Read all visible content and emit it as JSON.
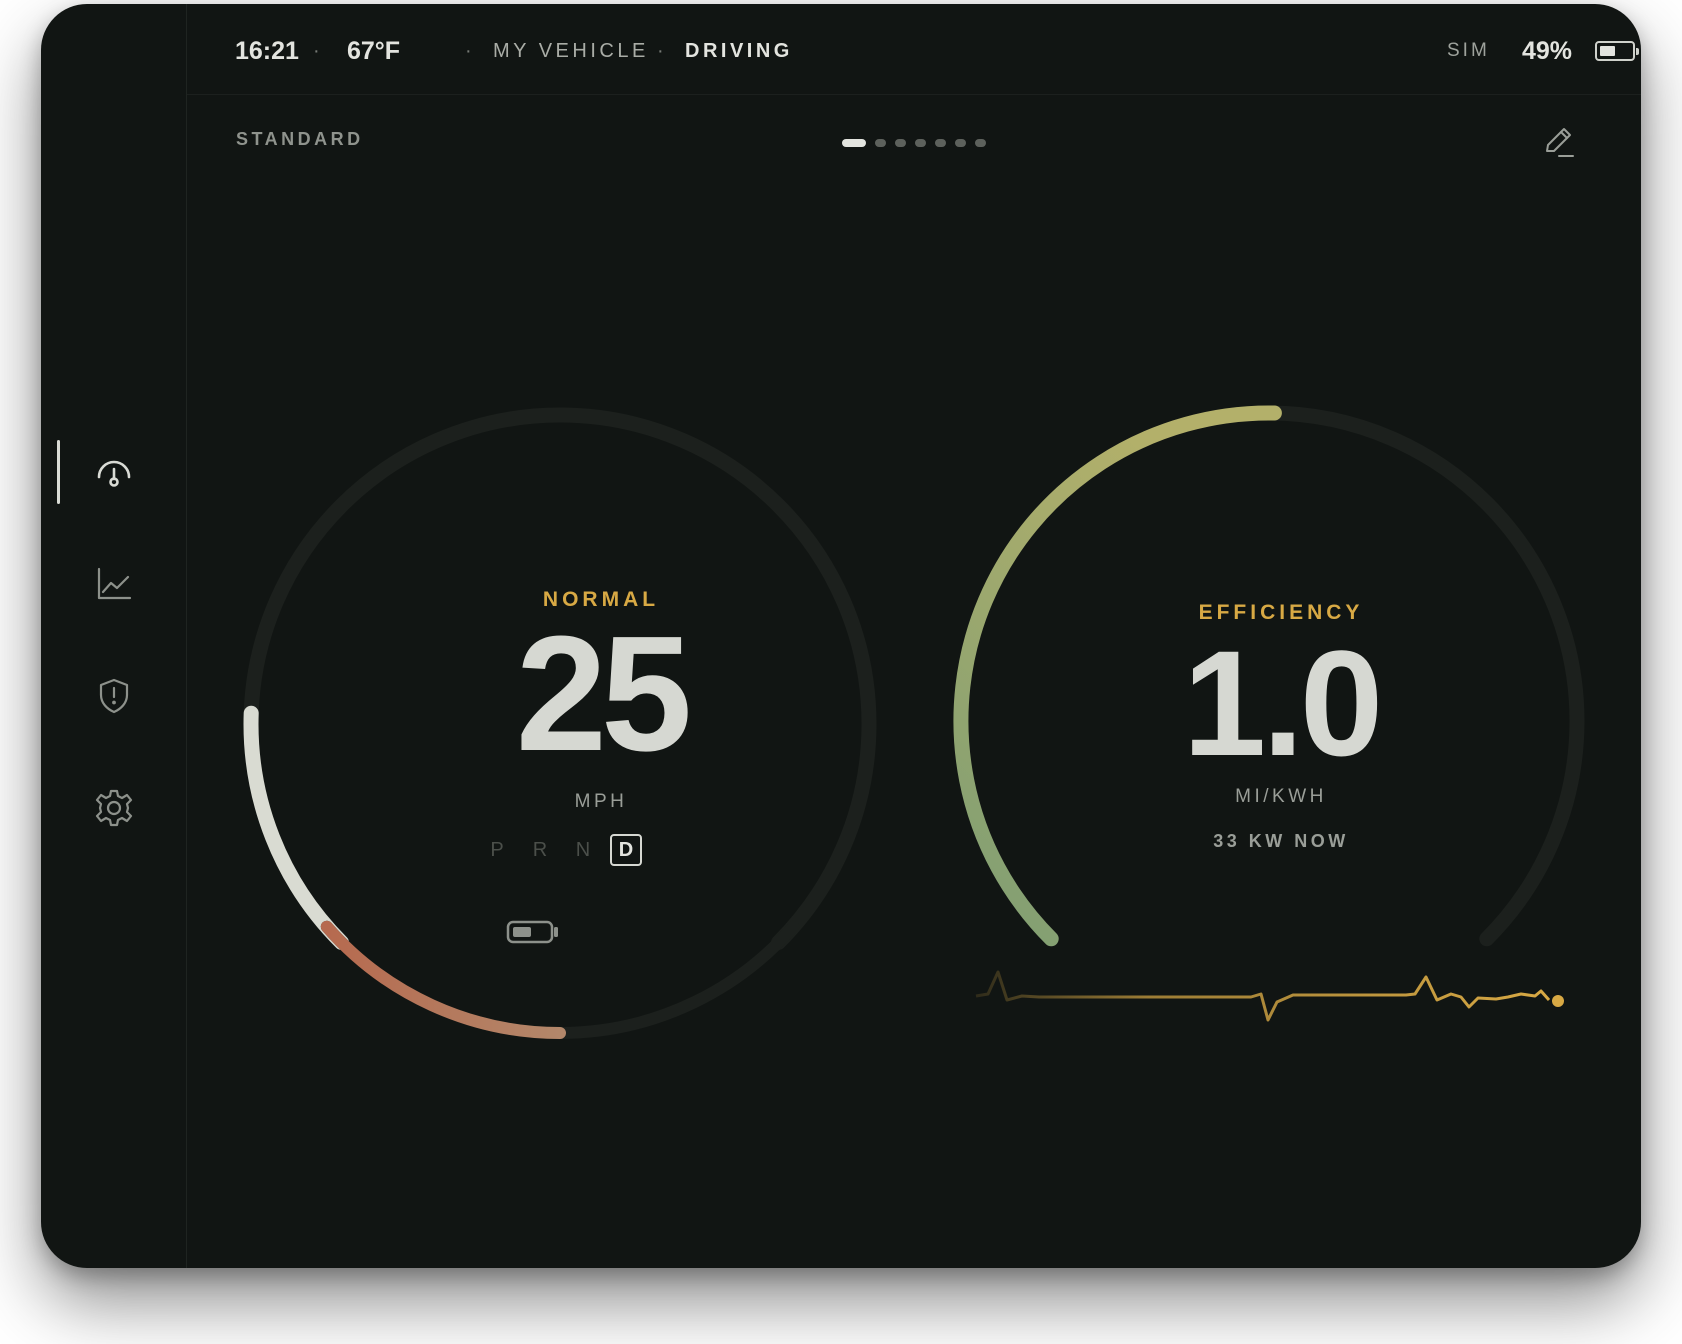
{
  "status_bar": {
    "time": "16:21",
    "separator": "·",
    "temperature": "67°F",
    "vehicle": "MY VEHICLE",
    "state": "DRIVING",
    "signal": "SIM",
    "battery_percent": "49%",
    "battery_level": 0.49
  },
  "sidebar": {
    "items": [
      {
        "icon": "gauge-icon",
        "active": true
      },
      {
        "icon": "chart-icon",
        "active": false
      },
      {
        "icon": "shield-alert-icon",
        "active": false
      },
      {
        "icon": "gear-icon",
        "active": false
      }
    ]
  },
  "header": {
    "mode": "STANDARD",
    "pages_count": 7,
    "active_page": 1,
    "edit_icon": "pencil-icon"
  },
  "speed_gauge": {
    "mode": "NORMAL",
    "value": "25",
    "unit": "MPH",
    "gears": [
      "P",
      "R",
      "N",
      "D"
    ],
    "active_gear": "D",
    "battery_icon": "battery-icon",
    "colors": {
      "arc": "#d9dbd2",
      "battery_arc_start": "#b66a4f",
      "battery_arc_end": "#b3876a",
      "track": "#1f2320"
    }
  },
  "efficiency_gauge": {
    "title": "EFFICIENCY",
    "value": "1.0",
    "unit": "MI/KWH",
    "power_now": "33 KW NOW",
    "colors": {
      "arc_start": "#7f9e73",
      "arc_end": "#b3b06a",
      "track": "#1f2320",
      "trace": "#d8a944"
    }
  }
}
